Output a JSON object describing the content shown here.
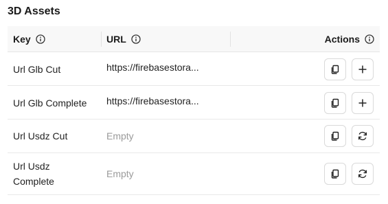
{
  "section": {
    "title": "3D Assets"
  },
  "table": {
    "headers": {
      "key": "Key",
      "url": "URL",
      "actions": "Actions"
    },
    "rows": [
      {
        "key": "Url Glb Cut",
        "url": "https://firebasestora...",
        "url_empty": false,
        "secondary_action": "plus-icon"
      },
      {
        "key": "Url Glb Complete",
        "url": "https://firebasestora...",
        "url_empty": false,
        "secondary_action": "plus-icon"
      },
      {
        "key": "Url Usdz Cut",
        "url": "Empty",
        "url_empty": true,
        "secondary_action": "refresh-icon"
      },
      {
        "key": "Url Usdz Complete",
        "url": "Empty",
        "url_empty": true,
        "secondary_action": "refresh-icon"
      }
    ]
  },
  "icons": {
    "header": "info-icon",
    "copy": "copy-icon"
  }
}
